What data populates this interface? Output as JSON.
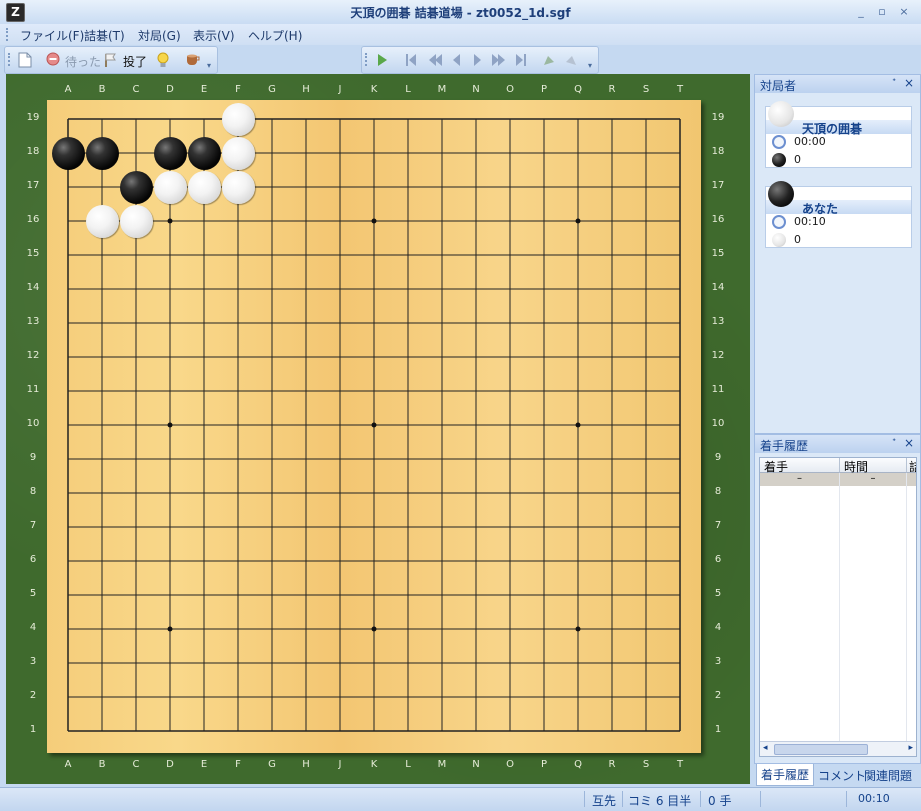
{
  "window": {
    "title": "天頂の囲碁 詰碁道場 - zt0052_1d.sgf",
    "app_icon_glyph": "Z",
    "min_glyph": "_",
    "restore_glyph": "▫",
    "close_glyph": "×"
  },
  "menu": [
    "ファイル(F)",
    "詰碁(T)",
    "対局(G)",
    "表示(V)",
    "ヘルプ(H)"
  ],
  "toolbar": {
    "new_icon": "new-file-icon",
    "undo_label": "待った",
    "resign_label": "投了",
    "hint_icon": "lightbulb-icon",
    "tea_icon": "tea-cup-icon",
    "nav_icons": [
      "play-icon",
      "first-icon",
      "back-fast-icon",
      "back-icon",
      "forward-icon",
      "forward-fast-icon",
      "last-icon",
      "rotate-left-icon",
      "rotate-right-icon"
    ]
  },
  "board": {
    "size": 19,
    "columns": [
      "A",
      "B",
      "C",
      "D",
      "E",
      "F",
      "G",
      "H",
      "J",
      "K",
      "L",
      "M",
      "N",
      "O",
      "P",
      "Q",
      "R",
      "S",
      "T"
    ],
    "rows": [
      "19",
      "18",
      "17",
      "16",
      "15",
      "14",
      "13",
      "12",
      "11",
      "10",
      "9",
      "8",
      "7",
      "6",
      "5",
      "4",
      "3",
      "2",
      "1"
    ],
    "hoshi": [
      "D16",
      "K16",
      "Q16",
      "D10",
      "K10",
      "Q10",
      "D4",
      "K4",
      "Q4"
    ],
    "black_stones": [
      "A18",
      "B18",
      "D18",
      "E18",
      "C17"
    ],
    "white_stones": [
      "F19",
      "F18",
      "D17",
      "E17",
      "F17",
      "B16",
      "C16"
    ]
  },
  "players_panel": {
    "title": "対局者",
    "white": {
      "name": "天頂の囲碁",
      "time": "00:00",
      "captures": "0"
    },
    "black": {
      "name": "あなた",
      "time": "00:10",
      "captures": "0"
    }
  },
  "history_panel": {
    "title": "着手履歴",
    "columns": [
      "着手",
      "時間",
      "詰"
    ],
    "rows": [
      [
        "–",
        "–"
      ]
    ]
  },
  "bottom_tabs": [
    "着手履歴",
    "コメント",
    "関連問題"
  ],
  "status": {
    "handicap": "互先",
    "komi": "コミ 6 目半",
    "moves": "0 手",
    "time": "00:10"
  }
}
